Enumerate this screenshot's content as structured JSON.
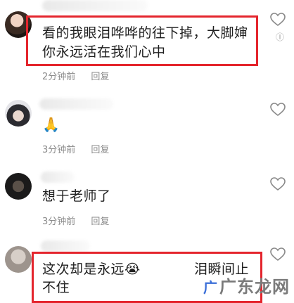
{
  "comments": [
    {
      "text_line1": "看的我眼泪哗哗的往下掉，大脚婶",
      "text_line2": "你永远活在我们心中",
      "time": "2分钟前",
      "reply": "回复",
      "side_icon": "Ⓘ"
    },
    {
      "text_line1": "🙏",
      "time": "3分钟前",
      "reply": "回复"
    },
    {
      "text_line1": "想于老师了",
      "time": "3分钟前",
      "reply": "回复"
    },
    {
      "text_line1a": "这次却是永远😭",
      "text_line1b": "泪瞬间止",
      "text_line2": "不住"
    }
  ],
  "watermark": {
    "prefix": "",
    "text": "广东龙网"
  },
  "colors": {
    "highlight": "#e4252d",
    "meta": "#8a8a8a"
  }
}
